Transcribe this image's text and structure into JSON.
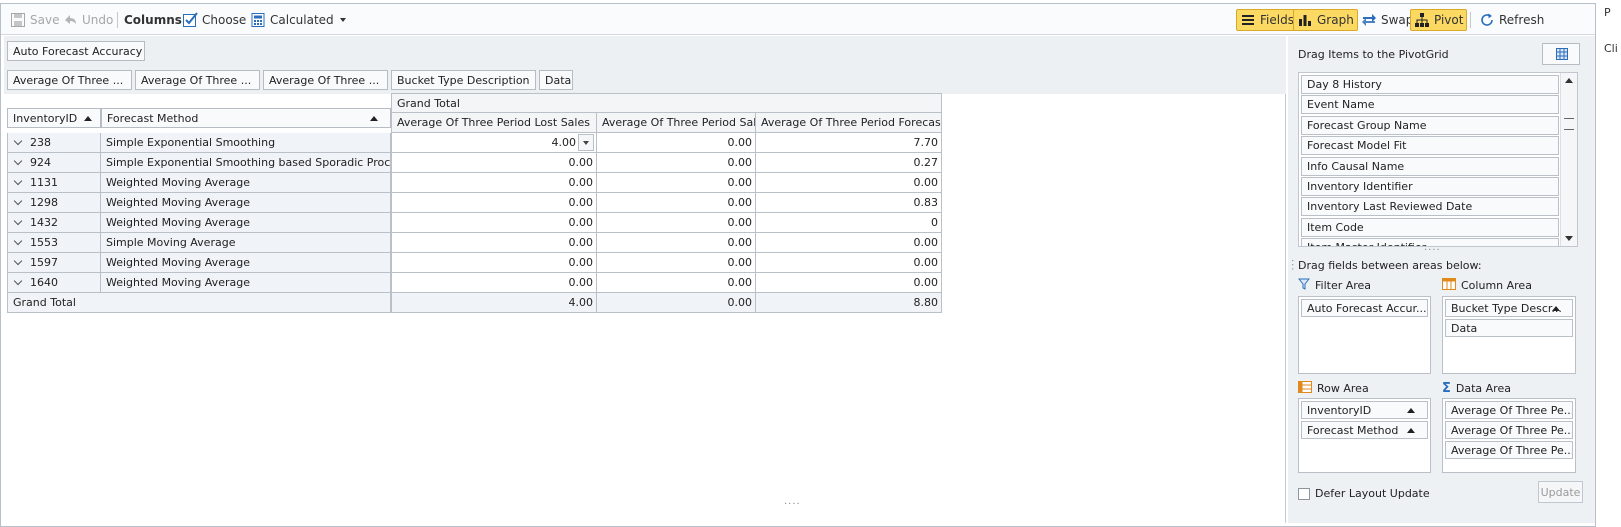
{
  "toolbar": {
    "save": "Save",
    "undo": "Undo",
    "columns": "Columns",
    "choose": "Choose",
    "calculated": "Calculated",
    "fields": "Fields",
    "graph": "Graph",
    "swap": "Swap",
    "pivot": "Pivot",
    "refresh": "Refresh"
  },
  "colors": {
    "toggle_bg": "#fbd963",
    "accent_blue": "#2a6ebb",
    "header_bg": "#edf0f3"
  },
  "pivot": {
    "filter_field": "Auto Forecast Accuracy",
    "data_fields": [
      "Average Of Three ...",
      "Average Of Three ...",
      "Average Of Three ..."
    ],
    "column_fields": [
      "Bucket Type Description",
      "Data"
    ],
    "row_fields": [
      "InventoryID",
      "Forecast Method"
    ],
    "grand_total_header": "Grand Total",
    "value_headers": [
      "Average Of Three Period Lost Sales",
      "Average Of Three Period Sales",
      "Average Of Three Period Forecasts"
    ],
    "rows": [
      {
        "id": "238",
        "method": "Simple Exponential Smoothing",
        "v1": "4.00",
        "v2": "0.00",
        "v3": "7.70"
      },
      {
        "id": "924",
        "method": "Simple Exponential Smoothing based Sporadic Processor",
        "v1": "0.00",
        "v2": "0.00",
        "v3": "0.27"
      },
      {
        "id": "1131",
        "method": "Weighted Moving Average",
        "v1": "0.00",
        "v2": "0.00",
        "v3": "0.00"
      },
      {
        "id": "1298",
        "method": "Weighted Moving Average",
        "v1": "0.00",
        "v2": "0.00",
        "v3": "0.83"
      },
      {
        "id": "1432",
        "method": "Weighted Moving Average",
        "v1": "0.00",
        "v2": "0.00",
        "v3": "0"
      },
      {
        "id": "1553",
        "method": "Simple Moving Average",
        "v1": "0.00",
        "v2": "0.00",
        "v3": "0.00"
      },
      {
        "id": "1597",
        "method": "Weighted Moving Average",
        "v1": "0.00",
        "v2": "0.00",
        "v3": "0.00"
      },
      {
        "id": "1640",
        "method": "Weighted Moving Average",
        "v1": "0.00",
        "v2": "0.00",
        "v3": "0.00"
      }
    ],
    "grand_total": {
      "label": "Grand Total",
      "v1": "4.00",
      "v2": "0.00",
      "v3": "8.80"
    }
  },
  "field_panel": {
    "title": "Drag Items to the PivotGrid",
    "fields": [
      "Day 8 History",
      "Event Name",
      "Forecast Group Name",
      "Forecast Model Fit",
      "Info Causal Name",
      "Inventory Identifier",
      "Inventory Last Reviewed Date",
      "Item Code",
      "Item Master Identifier"
    ],
    "drag_hint": "Drag fields between areas below:",
    "filter_area": {
      "label": "Filter Area",
      "items": [
        "Auto Forecast Accur..."
      ]
    },
    "column_area": {
      "label": "Column Area",
      "items": [
        "Bucket Type Descr...",
        "Data"
      ]
    },
    "row_area": {
      "label": "Row Area",
      "items": [
        "InventoryID",
        "Forecast Method"
      ]
    },
    "data_area": {
      "label": "Data Area",
      "items": [
        "Average Of Three Pe...",
        "Average Of Three Pe...",
        "Average Of Three Pe..."
      ]
    },
    "defer_label": "Defer Layout Update",
    "update": "Update"
  },
  "edge_text": {
    "top": "P",
    "bottom": "Cli"
  }
}
